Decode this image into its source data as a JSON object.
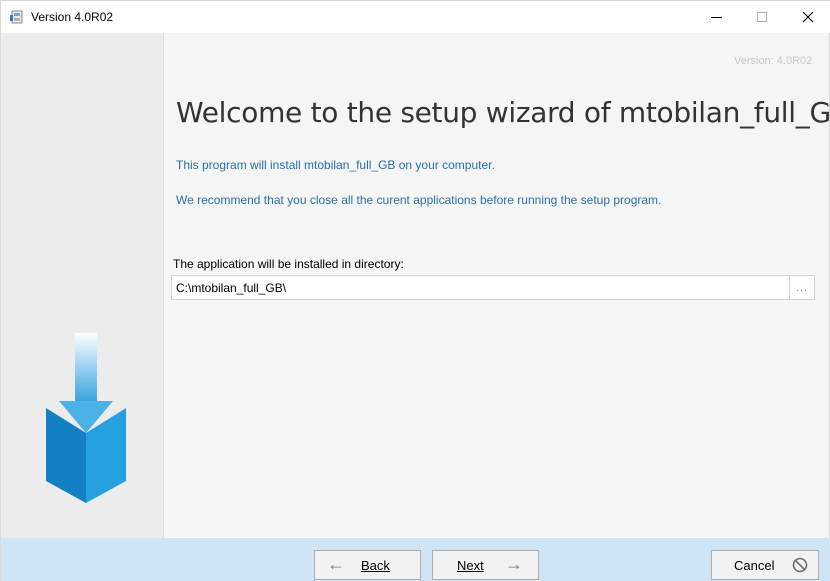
{
  "window": {
    "title": "Version 4.0R02",
    "controls": {
      "minimize": "minimize",
      "maximize": "maximize",
      "close": "X"
    }
  },
  "main": {
    "version_watermark": "Version: 4.0R02",
    "heading": "Welcome to the setup wizard of mtobilan_full_GB",
    "info_lines": [
      "This program will install mtobilan_full_GB on your computer.",
      "We recommend that you close all the curent applications before running the setup program."
    ],
    "directory_label": "The application will be installed in directory:",
    "directory_value": "C:\\mtobilan_full_GB\\",
    "browse_label": "..."
  },
  "footer": {
    "back_label": "Back",
    "next_label": "Next",
    "cancel_label": "Cancel"
  },
  "icons": {
    "app": "installer-icon",
    "back": "arrow-left-icon",
    "next": "arrow-right-icon",
    "cancel": "cancel-circle-icon",
    "graphic": "install-box-arrow-icon"
  },
  "colors": {
    "accent_text": "#2a6fa8",
    "footer_bg": "#cfe4f5",
    "graphic_blue": "#1a8fd1"
  }
}
